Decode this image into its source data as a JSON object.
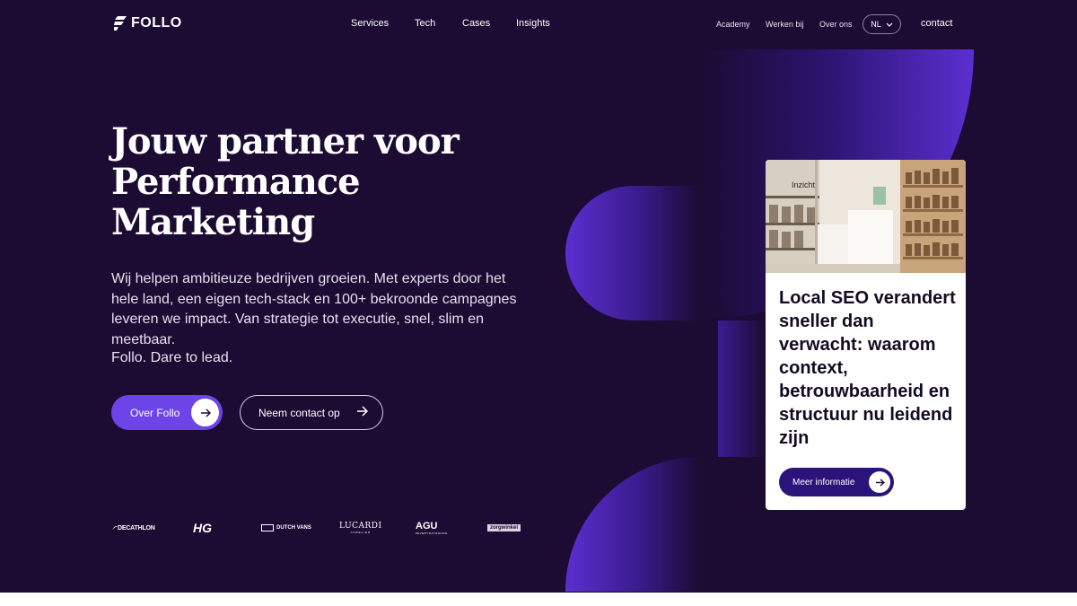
{
  "brand": {
    "name": "FOLLO",
    "icon": "follo-logo-icon"
  },
  "nav": {
    "main": [
      "Services",
      "Tech",
      "Cases",
      "Insights"
    ],
    "secondary": [
      "Academy",
      "Werken bij",
      "Over ons"
    ],
    "language": "NL",
    "contact": "contact"
  },
  "hero": {
    "headline_lines": [
      "Jouw partner voor",
      "Performance",
      "Marketing"
    ],
    "intro": "Wij helpen ambitieuze bedrijven groeien. Met experts door het hele land, een eigen tech-stack en 100+ bekroonde campagnes leveren we impact. Van strategie tot executie, snel, slim en meetbaar.",
    "tagline": "Follo. Dare to lead.",
    "primary_button": "Over Follo",
    "secondary_button": "Neem contact op"
  },
  "clients": [
    "DECATHLON",
    "HG",
    "DUTCH VANS",
    "LUCARDI",
    "AGU",
    "zorgwinkel"
  ],
  "client_sublines": {
    "lucardi": "JUWELIER",
    "agu": "#EVERYDAYRIDING"
  },
  "card": {
    "tag": "Inzicht",
    "title": "Local SEO verandert sneller dan verwacht: waarom context, betrouwbaarheid en structuur nu leidend zijn",
    "button": "Meer informatie"
  },
  "colors": {
    "background": "#1c0b33",
    "accent": "#6d44e8",
    "card_button": "#2b1479",
    "deco_purple": "#5b2fd1"
  }
}
